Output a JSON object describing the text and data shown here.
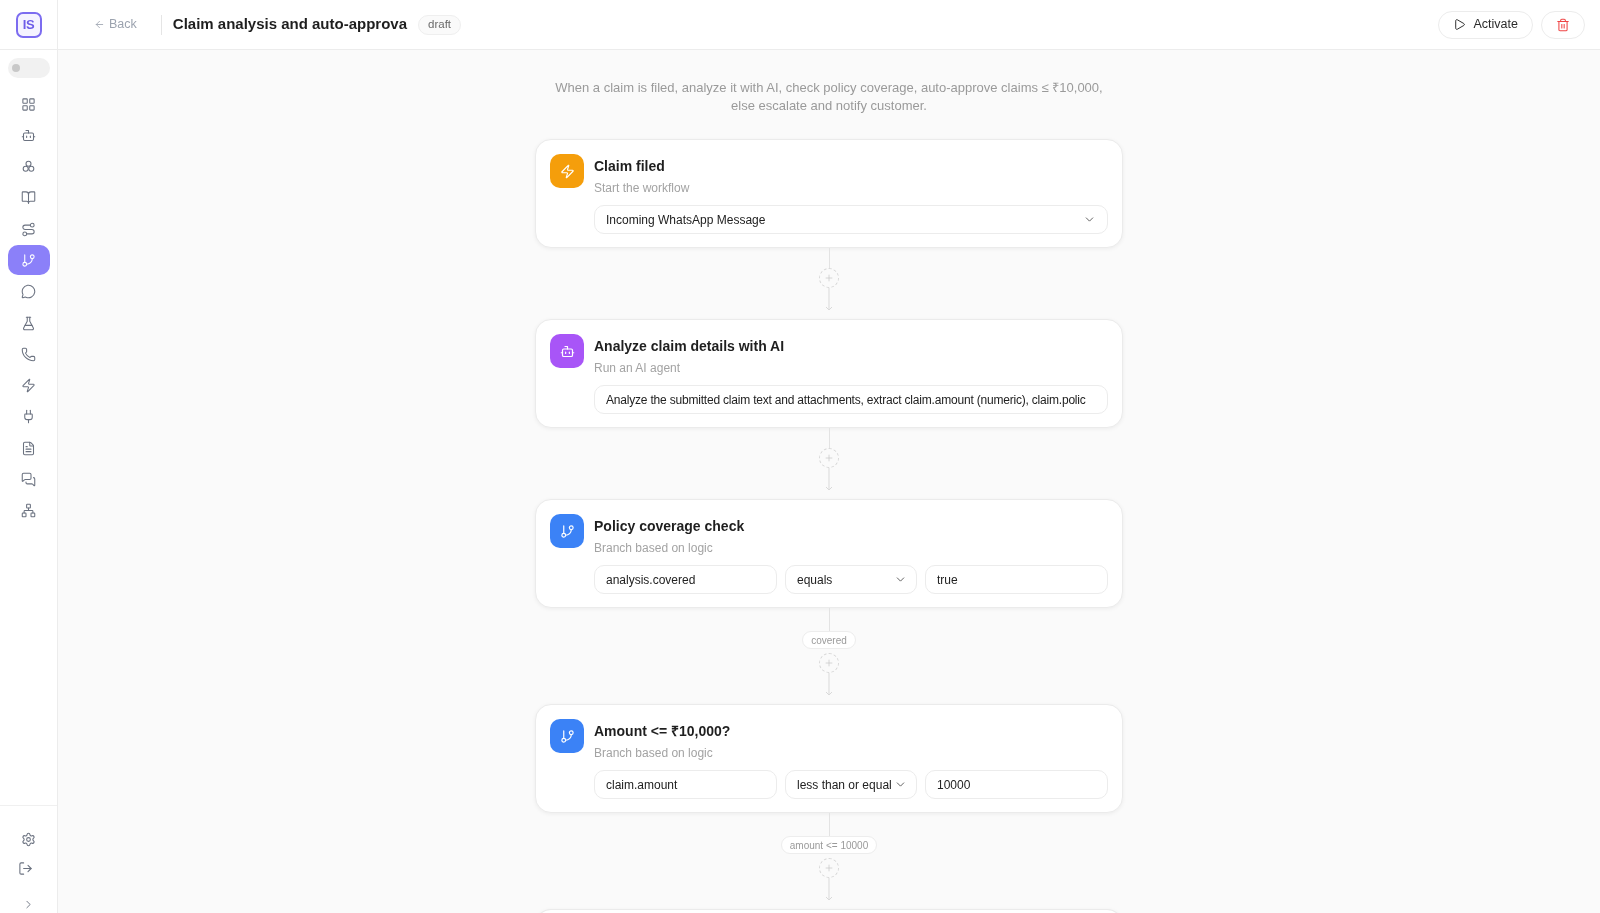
{
  "sidebar": {
    "logo": "IS",
    "toggle": {
      "on": false
    },
    "nav_items": [
      {
        "selected": false
      },
      {
        "selected": false
      },
      {
        "selected": false
      },
      {
        "selected": false
      },
      {
        "selected": false
      },
      {
        "selected": true
      },
      {
        "selected": false
      },
      {
        "selected": false
      },
      {
        "selected": false
      },
      {
        "selected": false
      },
      {
        "selected": false
      },
      {
        "selected": false
      },
      {
        "selected": false
      },
      {
        "selected": false
      }
    ]
  },
  "header": {
    "back": "Back",
    "title": "Claim analysis and auto-approva",
    "status": "draft",
    "activate": "Activate"
  },
  "description": "When a claim is filed, analyze it with AI, check policy coverage, auto-approve claims ≤ ₹10,000, else escalate and notify customer.",
  "steps": [
    {
      "kind": "trigger",
      "title": "Claim filed",
      "subtitle": "Start the workflow",
      "select": "Incoming WhatsApp Message"
    },
    {
      "kind": "agent",
      "title": "Analyze claim details with AI",
      "subtitle": "Run an AI agent",
      "prompt": "Analyze the submitted claim text and attachments, extract claim.amount (numeric), claim.polic"
    },
    {
      "kind": "condition",
      "title": "Policy coverage check",
      "subtitle": "Branch based on logic",
      "field": "analysis.covered",
      "operator": "equals",
      "value": "true",
      "branch_label": "covered"
    },
    {
      "kind": "condition",
      "title": "Amount <= ₹10,000?",
      "subtitle": "Branch based on logic",
      "field": "claim.amount",
      "operator": "less than or equal",
      "value": "10000",
      "branch_label": "amount <= 10000"
    }
  ]
}
